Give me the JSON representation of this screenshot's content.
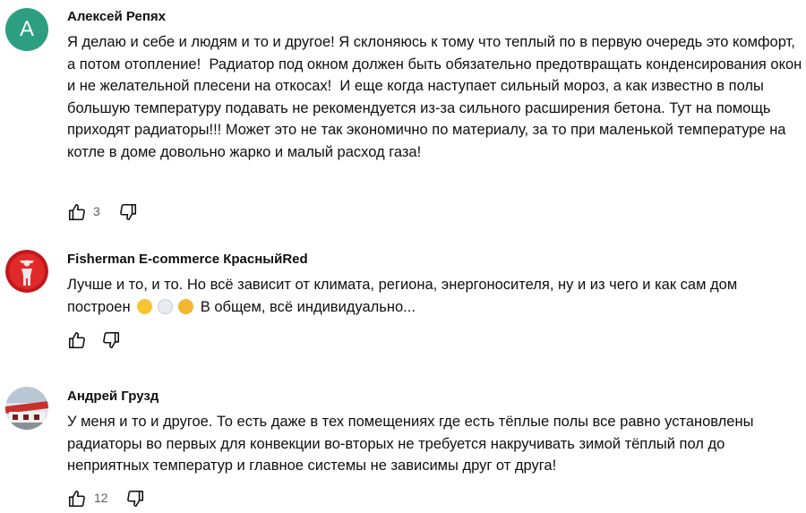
{
  "comments": [
    {
      "author": "Алексей Репях",
      "avatar_letter": "А",
      "text": "Я делаю и себе и людям и то и другое! Я склоняюсь к тому что теплый по в первую очередь это комфорт, а потом отопление!  Радиатор под окном должен быть обязательно предотвращать конденсирования окон и не желательной плесени на откосах!  И еще когда наступает сильный мороз, а как известно в полы большую температуру подавать не рекомендуется из-за сильного расширения бетона. Тут на помощь приходят радиаторы!!! Может это не так экономично по материалу, за то при маленькой температуре на котле в доме довольно жарко и малый расход газа!",
      "likes": "3"
    },
    {
      "author": "Fisherman E-commerce КрасныйRed",
      "text_before": "Лучше и то, и то. Но всё зависит от климата, региона, энергоносителя, ну и из чего и как сам дом построен",
      "text_after": "В общем, всё индивидуально...",
      "emojis": [
        "face-savoring-emoji",
        "ghost-emoji",
        "thinking-face-emoji"
      ],
      "likes": ""
    },
    {
      "author": "Андрей Грузд",
      "text": "У меня и то и другое. То есть даже в тех помещениях где есть тёплые полы все равно установлены радиаторы во первых для конвекции во-вторых не требуется накручивать зимой тёплый пол до неприятных температур и главное системы не зависимы друг от друга!",
      "likes": "12"
    }
  ],
  "icons": {
    "like": "thumbs-up-icon",
    "dislike": "thumbs-down-icon"
  },
  "colors": {
    "avatar_bg": "#2e9e82",
    "text": "#0f0f0f",
    "secondary_text": "#606060"
  }
}
